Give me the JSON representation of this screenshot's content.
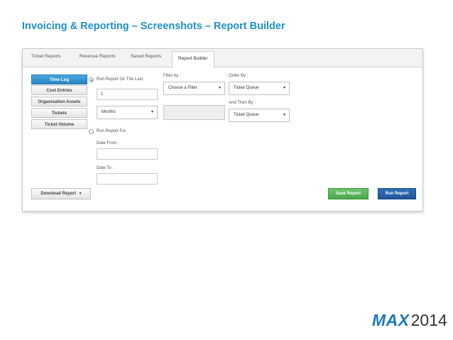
{
  "slide": {
    "title": "Invoicing & Reporting – Screenshots – Report Builder"
  },
  "tabs": [
    {
      "label": "Ticket Reports",
      "active": false
    },
    {
      "label": "Revenue Reports",
      "active": false
    },
    {
      "label": "Saved Reports",
      "active": false
    },
    {
      "label": "Report Builder",
      "active": true
    }
  ],
  "sidebar": {
    "items": [
      {
        "label": "Time Log",
        "active": true
      },
      {
        "label": "Cost Entries",
        "active": false
      },
      {
        "label": "Organisation Assets",
        "active": false
      },
      {
        "label": "Tickets",
        "active": false
      },
      {
        "label": "Ticket Volume",
        "active": false
      }
    ]
  },
  "form": {
    "run_last_label": "Run Report On The Last",
    "run_last_value": "1",
    "period_select": "Months",
    "run_for_label": "Run Report For",
    "date_from_label": "Date From :",
    "date_from_value": "",
    "date_to_label": "Date To :",
    "date_to_value": "",
    "filter_label": "Filter by :",
    "filter_select": "Choose a Filter",
    "filter_value": "",
    "order_label": "Order By :",
    "order_select": "Ticket Queue",
    "then_label": "And Then By :",
    "then_select": "Ticket Queue"
  },
  "buttons": {
    "download": "Download Report",
    "save": "Save Report",
    "run": "Run Report"
  },
  "icons": {
    "caret": "▾"
  },
  "brand": {
    "name": "MAX",
    "year": "2014"
  },
  "colors": {
    "title": "#1f8fc9",
    "active_tab_button": "#2a85c4",
    "save_button": "#48a848",
    "run_button": "#1f5597"
  }
}
